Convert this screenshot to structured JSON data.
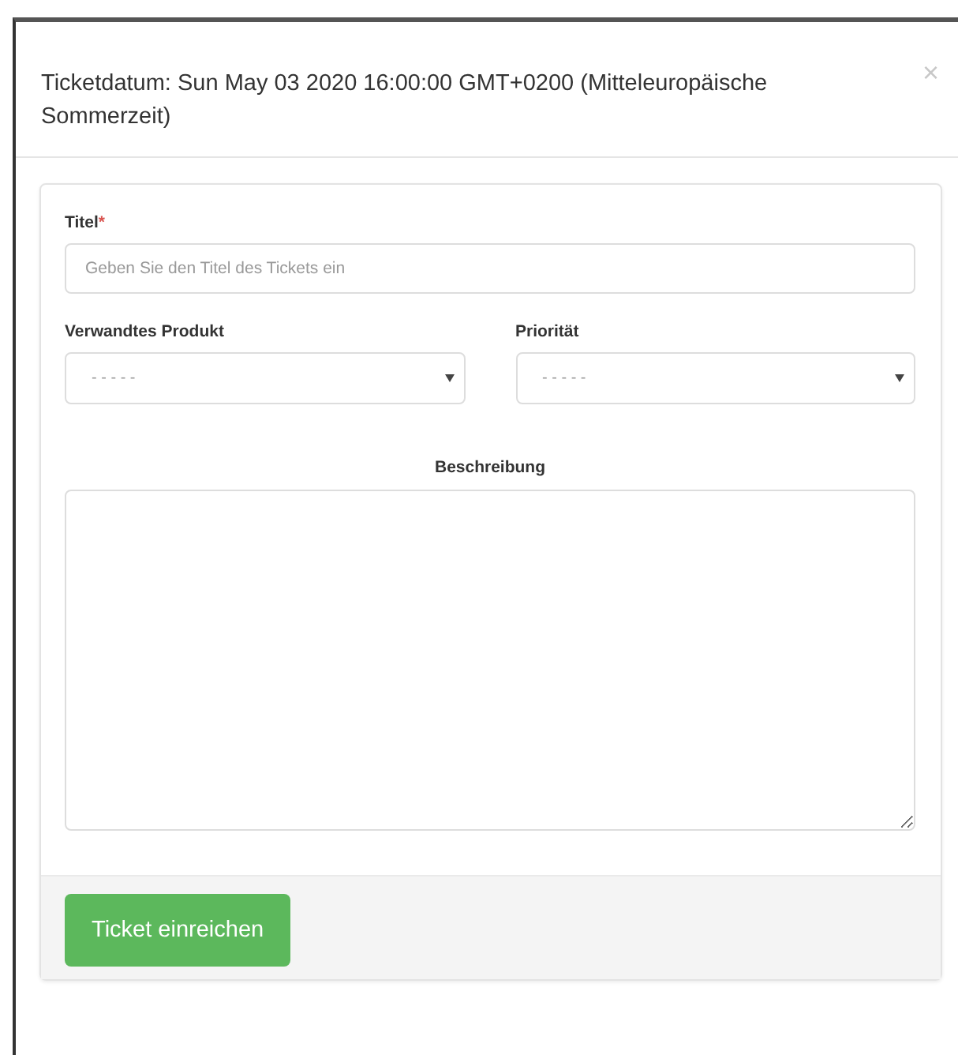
{
  "modal": {
    "title": "Ticketdatum: Sun May 03 2020 16:00:00 GMT+0200 (Mitteleuropäische Sommerzeit)",
    "close": "×"
  },
  "form": {
    "title_field": {
      "label": "Titel",
      "required_mark": "*",
      "placeholder": "Geben Sie den Titel des Tickets ein"
    },
    "selects": [
      {
        "label": "Verwandtes Produkt",
        "value": "- - - - -"
      },
      {
        "label": "Priorität",
        "value": "- - - - -"
      }
    ],
    "description": {
      "label": "Beschreibung"
    },
    "submit": "Ticket einreichen"
  }
}
